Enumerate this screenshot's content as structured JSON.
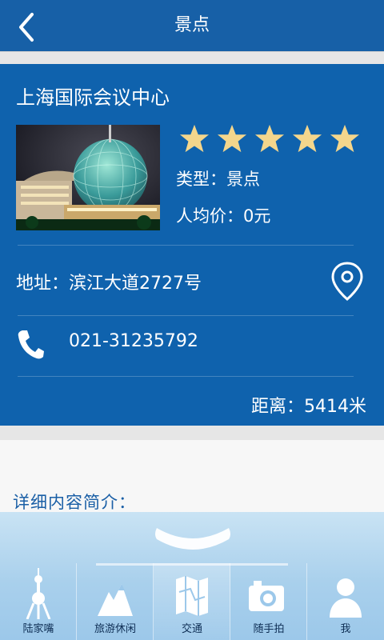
{
  "header": {
    "title": "景点"
  },
  "place": {
    "name": "上海国际会议中心",
    "rating": 5,
    "type_text": "类型：景点",
    "avg_price_text": "人均价：0元",
    "address_text": "地址：滨江大道2727号",
    "phone": "021-31235792",
    "distance_text": "距离：5414米"
  },
  "detail": {
    "intro_label": "详细内容简介："
  },
  "tabs": [
    {
      "label": "陆家嘴",
      "icon": "tower-icon"
    },
    {
      "label": "旅游休闲",
      "icon": "mountain-icon"
    },
    {
      "label": "交通",
      "icon": "map-icon"
    },
    {
      "label": "随手拍",
      "icon": "camera-icon"
    },
    {
      "label": "我",
      "icon": "person-icon"
    }
  ],
  "colors": {
    "header": "#1760a7",
    "card": "#0f62ad",
    "star": "#f4d68c"
  }
}
